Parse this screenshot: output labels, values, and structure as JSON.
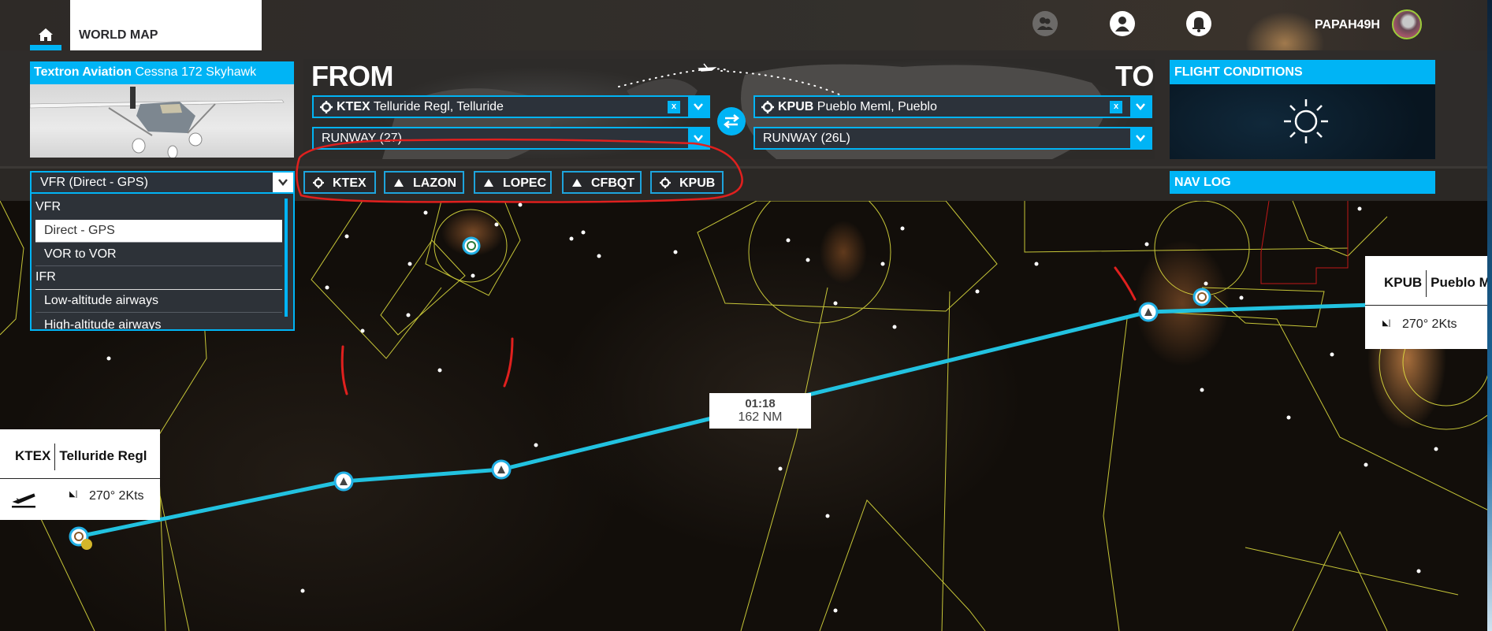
{
  "topbar": {
    "home_icon": "home-icon",
    "world_map_tab": "WORLD MAP",
    "icons": [
      "friends-icon",
      "profile-icon",
      "notifications-bell-icon"
    ],
    "username": "PAPAH49H",
    "accent_color": "#00b4f5"
  },
  "aircraft": {
    "brand": "Textron Aviation",
    "model": "Cessna 172 Skyhawk"
  },
  "route": {
    "from_label": "FROM",
    "to_label": "TO",
    "departure": {
      "icao": "KTEX",
      "name": "Telluride Regl, Telluride",
      "runway": "RUNWAY (27)",
      "clear_label": "x"
    },
    "arrival": {
      "icao": "KPUB",
      "name": "Pueblo Meml, Pueblo",
      "runway": "RUNWAY (26L)",
      "clear_label": "x"
    },
    "swap_icon": "swap-arrows-icon"
  },
  "flight_conditions": {
    "title": "FLIGHT CONDITIONS",
    "weather_icon": "sun-icon"
  },
  "nav_log": {
    "title": "NAV LOG"
  },
  "flight_type": {
    "selected": "VFR (Direct - GPS)",
    "groups": [
      {
        "label": "VFR",
        "options": [
          {
            "label": "Direct - GPS",
            "selected": true
          },
          {
            "label": "VOR to VOR",
            "selected": false
          }
        ]
      },
      {
        "label": "IFR",
        "options": [
          {
            "label": "Low-altitude airways",
            "selected": false
          },
          {
            "label": "High-altitude airways",
            "selected": false
          }
        ]
      }
    ]
  },
  "waypoints": [
    {
      "id": "KTEX",
      "type": "airport"
    },
    {
      "id": "LAZON",
      "type": "intersection"
    },
    {
      "id": "LOPEC",
      "type": "intersection"
    },
    {
      "id": "CFBQT",
      "type": "intersection"
    },
    {
      "id": "KPUB",
      "type": "airport"
    }
  ],
  "map": {
    "departure_card": {
      "icao": "KTEX",
      "name": "Telluride Regl",
      "wind": "270° 2Kts",
      "icon": "takeoff-icon"
    },
    "arrival_card": {
      "icao": "KPUB",
      "name": "Pueblo Me",
      "wind": "270° 2Kts"
    },
    "leg_info": {
      "time": "01:18",
      "distance": "162 NM"
    },
    "route_color": "#22c2e0",
    "airspace_color": "#e6e640",
    "annotation_color": "#e0201e"
  }
}
